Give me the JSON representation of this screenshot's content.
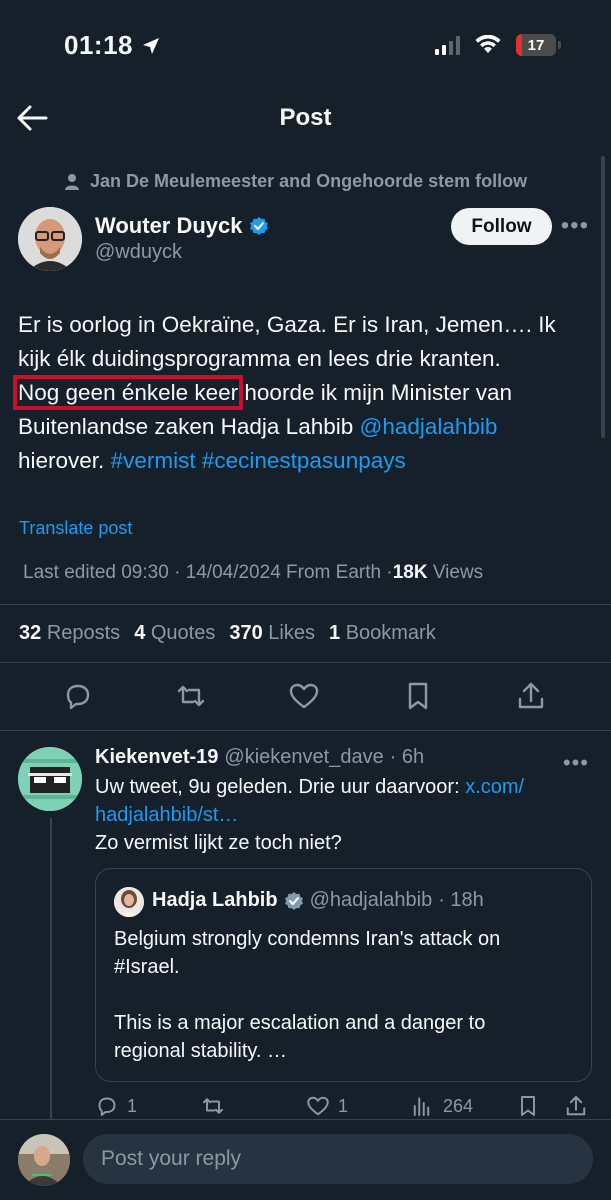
{
  "status_bar": {
    "time": "01:18",
    "battery": "17"
  },
  "header": {
    "title": "Post"
  },
  "social_context": "Jan De Meulemeester and Ongehoorde stem follow",
  "author": {
    "name": "Wouter Duyck",
    "handle": "@wduyck",
    "verified": true,
    "follow_label": "Follow"
  },
  "tweet": {
    "line_1": "Er is oorlog in Oekraïne, Gaza. Er is Iran, Jemen…. Ik",
    "line_2": "kijk élk duidingsprogramma en lees drie kranten.",
    "highlighted": "Nog geen énkele keer",
    "line_3_rest": " hoorde ik mijn Minister van",
    "line_4_text": "Buitenlandse zaken Hadja Lahbib ",
    "mention": "@hadjalahbib",
    "line_5_text": "hierover. ",
    "hashtag_1": "#vermist",
    "hashtag_2": "#cecinestpasunpays",
    "translate_label": "Translate post"
  },
  "meta": {
    "edited": "Last edited 09:30 · 14/04/2024",
    "source": "From Earth",
    "separator": "·",
    "views_count": "18K",
    "views_label": "Views"
  },
  "stats": {
    "reposts_count": "32",
    "reposts_label": "Reposts",
    "quotes_count": "4",
    "quotes_label": "Quotes",
    "likes_count": "370",
    "likes_label": "Likes",
    "bookmarks_count": "1",
    "bookmarks_label": "Bookmark"
  },
  "reply": {
    "name": "Kiekenvet-19",
    "handle": "@kiekenvet_dave",
    "time": "· 6h",
    "text_1": "Uw tweet, 9u geleden. Drie uur daarvoor: ",
    "link_1": "x.com/",
    "link_2": "hadjalahbib/st…",
    "text_2": "Zo vermist lijkt ze toch niet?",
    "quote": {
      "name": "Hadja Lahbib",
      "handle": "@hadjalahbib",
      "time": "· 18h",
      "text_1": "Belgium strongly condemns Iran's attack on",
      "text_2": "#Israel.",
      "text_3": "This is a major escalation and a danger to",
      "text_4": "regional stability. …"
    },
    "actions": {
      "replies": "1",
      "reposts": "",
      "likes": "1",
      "views": "264"
    }
  },
  "composer": {
    "placeholder": "Post your reply"
  },
  "colors": {
    "background": "#15202b",
    "accent": "#1d9bf0",
    "muted": "#8b98a5",
    "highlight_box": "#c8102e"
  }
}
